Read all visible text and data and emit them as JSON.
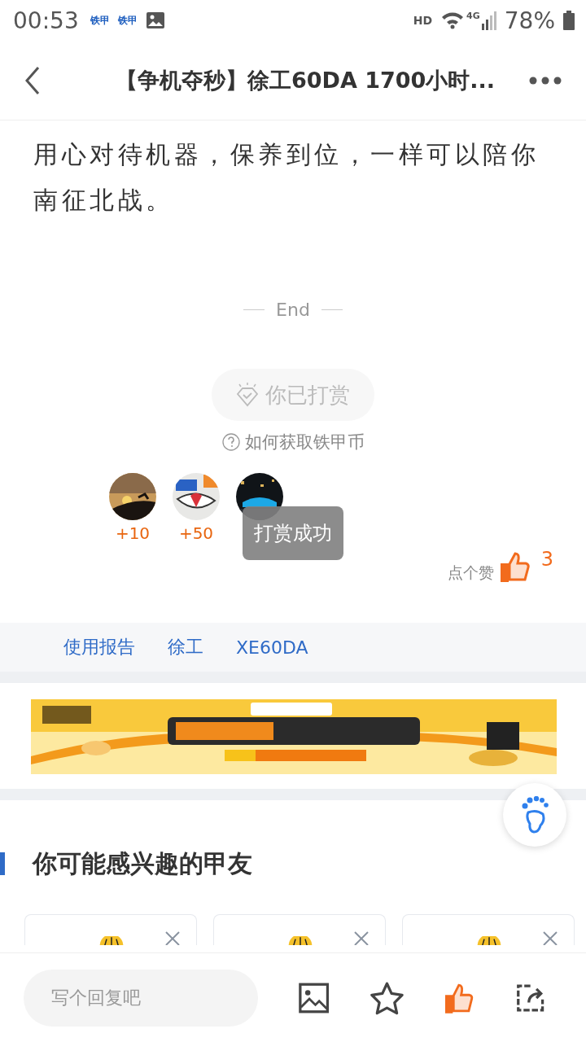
{
  "status_bar": {
    "time": "00:53",
    "notifications": [
      "铁甲",
      "铁甲"
    ],
    "hd": "HD",
    "network": "4G",
    "battery": "78%"
  },
  "header": {
    "title": "【争机夺秒】徐工60DA 1700小时..."
  },
  "article": {
    "text": "用心对待机器，保养到位，一样可以陪你南征北战。",
    "end": "End"
  },
  "reward": {
    "label": "你已打赏",
    "rewarded": true,
    "help": "如何获取铁甲币"
  },
  "rewarders": [
    {
      "kind": "picture",
      "amount": "+10"
    },
    {
      "kind": "picture",
      "amount": "+50"
    },
    {
      "kind": "picture"
    }
  ],
  "toast": "打赏成功",
  "like": {
    "label": "点个赞",
    "count": "3",
    "liked": true
  },
  "tags": [
    "使用报告",
    "徐工",
    "XE60DA"
  ],
  "banner": {
    "kind": "picture"
  },
  "section": {
    "title": "你可能感兴趣的甲友"
  },
  "cards": [
    {
      "kind": "picture"
    },
    {
      "kind": "picture"
    },
    {
      "kind": "picture"
    }
  ],
  "bottom_bar": {
    "placeholder": "写个回复吧",
    "liked": true
  }
}
